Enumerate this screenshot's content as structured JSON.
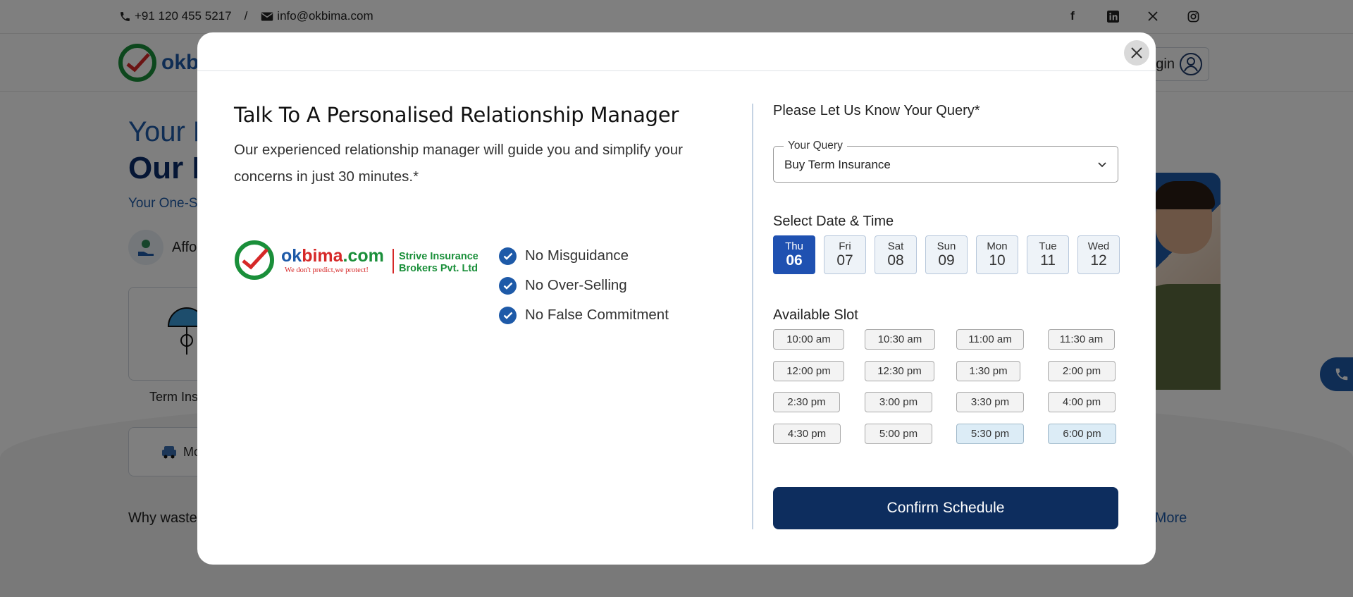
{
  "topbar": {
    "phone": "+91 120 455 5217",
    "separator": "/",
    "email": "info@okbima.com",
    "social_icons": [
      "facebook-icon",
      "linkedin-icon",
      "x-icon",
      "instagram-icon"
    ]
  },
  "navbar": {
    "logo_text": "okbi",
    "login_label": "Login"
  },
  "hero": {
    "title_line1": "Your P",
    "title_line2": "Our I",
    "subtitle": "Your One-S",
    "afford_label": "Affo",
    "card_term_label": "Term Ins",
    "card_motor_label": "Mo",
    "why_text": "Why waste",
    "read_more": "d More"
  },
  "modal": {
    "title": "Talk To A Personalised Relationship Manager",
    "description": "Our experienced relationship manager will guide you and simplify your concerns in just 30 minutes.*",
    "brand": {
      "name_ok": "ok",
      "name_bima": "bima",
      "name_com": ".com",
      "tagline": "We don't predict,we protect!",
      "partner_line1": "Strive Insurance",
      "partner_line2": "Brokers Pvt. Ltd."
    },
    "features": [
      "No Misguidance",
      "No Over-Selling",
      "No False Commitment"
    ],
    "query_title": "Please Let Us Know Your Query*",
    "query_label": "Your Query",
    "query_value": "Buy Term Insurance",
    "date_time_title": "Select Date & Time",
    "dates": [
      {
        "day": "Thu",
        "num": "06",
        "selected": true
      },
      {
        "day": "Fri",
        "num": "07",
        "selected": false
      },
      {
        "day": "Sat",
        "num": "08",
        "selected": false
      },
      {
        "day": "Sun",
        "num": "09",
        "selected": false
      },
      {
        "day": "Mon",
        "num": "10",
        "selected": false
      },
      {
        "day": "Tue",
        "num": "11",
        "selected": false
      },
      {
        "day": "Wed",
        "num": "12",
        "selected": false
      }
    ],
    "slot_title": "Available Slot",
    "slots": [
      "10:00 am",
      "10:30 am",
      "11:00 am",
      "11:30 am",
      "12:00 pm",
      "12:30 pm",
      "1:30 pm",
      "2:00 pm",
      "2:30 pm",
      "3:00 pm",
      "3:30 pm",
      "4:00 pm",
      "4:30 pm",
      "5:00 pm",
      "5:30 pm",
      "6:00 pm"
    ],
    "highlighted_slots": [
      "5:30 pm",
      "6:00 pm"
    ],
    "confirm_label": "Confirm Schedule"
  },
  "colors": {
    "primary_navy": "#0d2d5e",
    "selected_date": "#1f51b1",
    "brand_blue": "#1e5aa8",
    "brand_green": "#1a8f3a",
    "brand_red": "#d62828"
  }
}
